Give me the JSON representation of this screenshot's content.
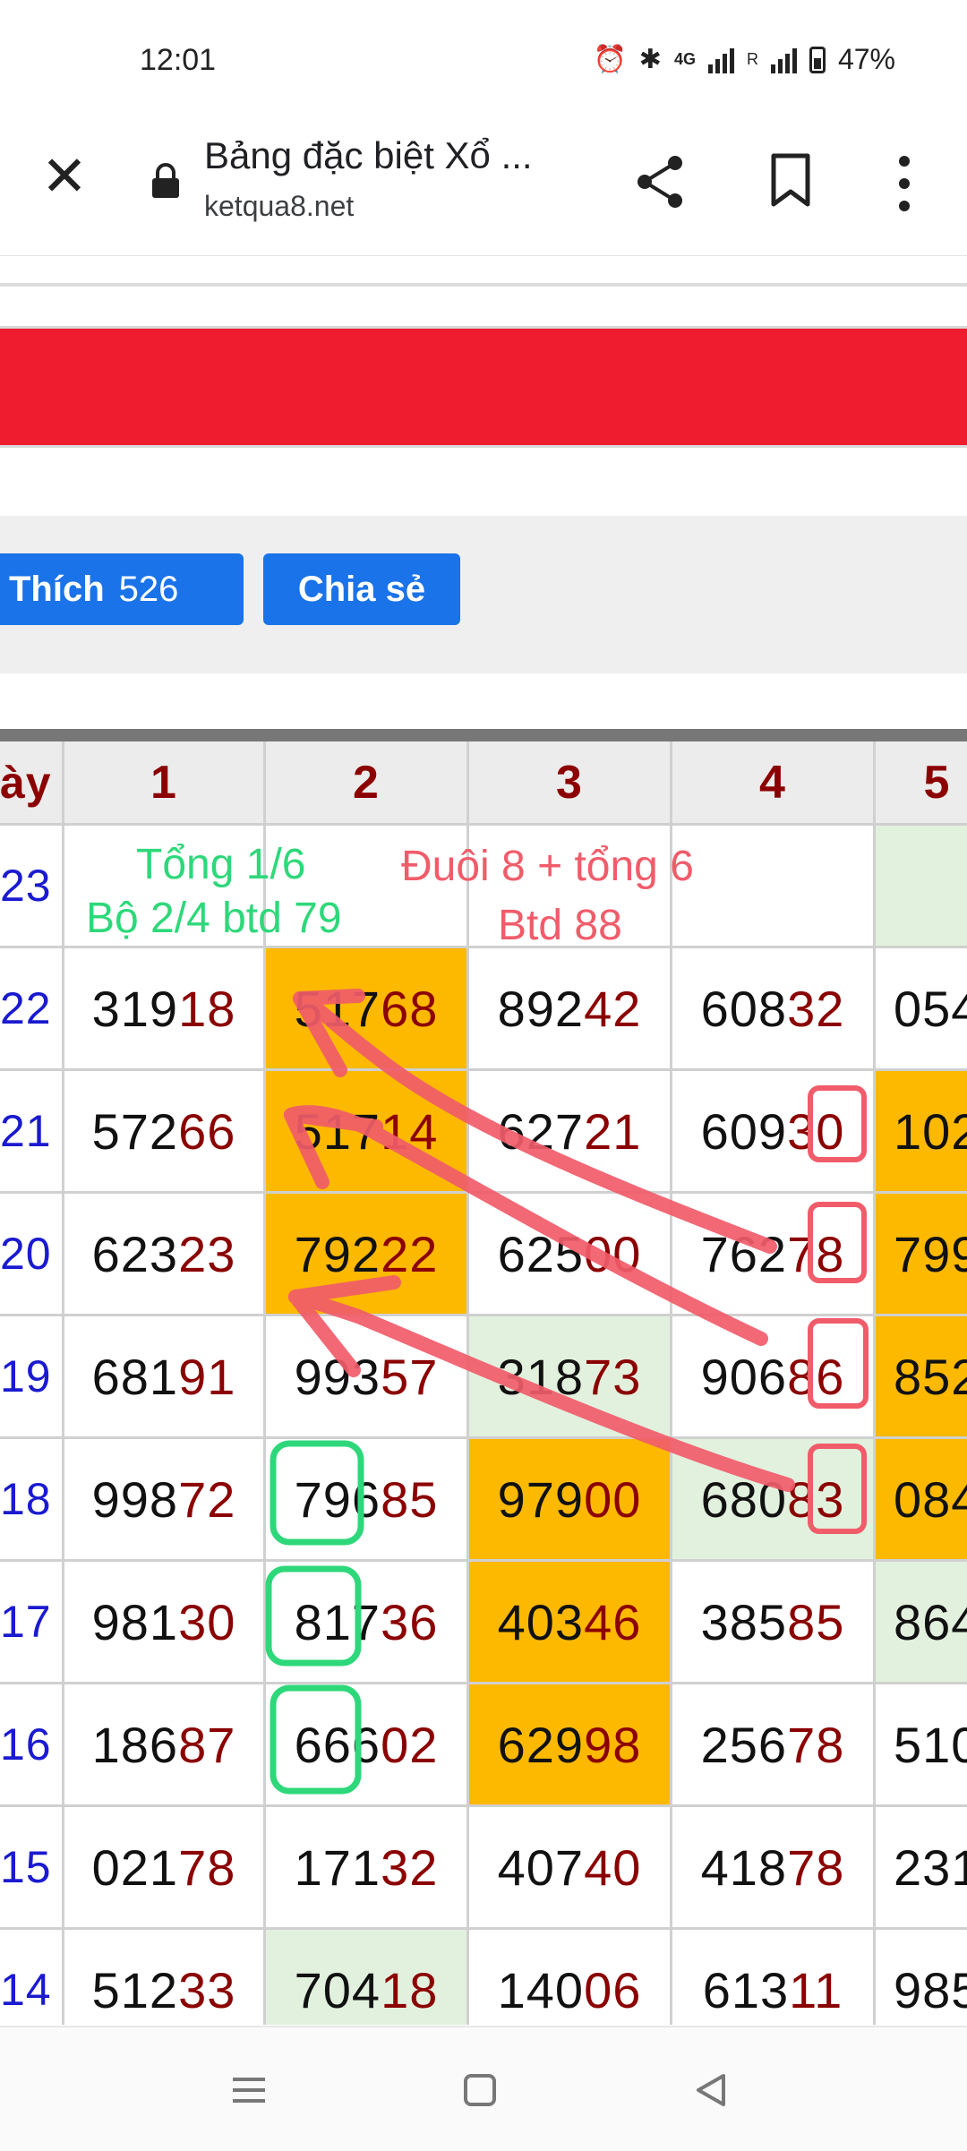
{
  "status_bar": {
    "time": "12:01",
    "network": "4G",
    "roaming": "R",
    "battery": "47%",
    "icons": [
      "alarm-icon",
      "bluetooth-icon",
      "signal-icon",
      "battery-icon"
    ]
  },
  "browser": {
    "title": "Bảng đặc biệt Xổ ...",
    "url": "ketqua8.net",
    "icons": [
      "close-icon",
      "lock-icon",
      "share-icon",
      "bookmark-icon",
      "more-icon"
    ]
  },
  "social": {
    "like_label": "Thích",
    "like_count": "526",
    "share_label": "Chia sẻ"
  },
  "table": {
    "first_header": "ày",
    "columns": [
      "1",
      "2",
      "3",
      "4",
      "5"
    ],
    "rows": [
      {
        "label": "23",
        "cells": [
          {
            "head": "",
            "tail": ""
          },
          {
            "head": "",
            "tail": ""
          },
          {
            "head": "",
            "tail": ""
          },
          {
            "head": "",
            "tail": ""
          },
          {
            "head": "",
            "tail": ""
          }
        ]
      },
      {
        "label": "22",
        "cells": [
          {
            "head": "319",
            "tail": "18"
          },
          {
            "head": "517",
            "tail": "68"
          },
          {
            "head": "892",
            "tail": "42"
          },
          {
            "head": "608",
            "tail": "32"
          },
          {
            "head": "054",
            "tail": ""
          }
        ]
      },
      {
        "label": "21",
        "cells": [
          {
            "head": "572",
            "tail": "66"
          },
          {
            "head": "517",
            "tail": "14"
          },
          {
            "head": "627",
            "tail": "21"
          },
          {
            "head": "609",
            "tail": "30"
          },
          {
            "head": "102",
            "tail": ""
          }
        ]
      },
      {
        "label": "20",
        "cells": [
          {
            "head": "623",
            "tail": "23"
          },
          {
            "head": "792",
            "tail": "22"
          },
          {
            "head": "625",
            "tail": "00"
          },
          {
            "head": "762",
            "tail": "78"
          },
          {
            "head": "799",
            "tail": ""
          }
        ]
      },
      {
        "label": "19",
        "cells": [
          {
            "head": "681",
            "tail": "91"
          },
          {
            "head": "993",
            "tail": "57"
          },
          {
            "head": "318",
            "tail": "73"
          },
          {
            "head": "906",
            "tail": "86"
          },
          {
            "head": "852",
            "tail": ""
          }
        ]
      },
      {
        "label": "18",
        "cells": [
          {
            "head": "998",
            "tail": "72"
          },
          {
            "head": "796",
            "tail": "85"
          },
          {
            "head": "979",
            "tail": "00"
          },
          {
            "head": "680",
            "tail": "83"
          },
          {
            "head": "084",
            "tail": ""
          }
        ]
      },
      {
        "label": "17",
        "cells": [
          {
            "head": "981",
            "tail": "30"
          },
          {
            "head": "817",
            "tail": "36"
          },
          {
            "head": "403",
            "tail": "46"
          },
          {
            "head": "385",
            "tail": "85"
          },
          {
            "head": "864",
            "tail": ""
          }
        ]
      },
      {
        "label": "16",
        "cells": [
          {
            "head": "186",
            "tail": "87"
          },
          {
            "head": "666",
            "tail": "02"
          },
          {
            "head": "629",
            "tail": "98"
          },
          {
            "head": "256",
            "tail": "78"
          },
          {
            "head": "510",
            "tail": ""
          }
        ]
      },
      {
        "label": "15",
        "cells": [
          {
            "head": "021",
            "tail": "78"
          },
          {
            "head": "171",
            "tail": "32"
          },
          {
            "head": "407",
            "tail": "40"
          },
          {
            "head": "418",
            "tail": "78"
          },
          {
            "head": "231",
            "tail": ""
          }
        ]
      },
      {
        "label": "14",
        "cells": [
          {
            "head": "512",
            "tail": "33"
          },
          {
            "head": "704",
            "tail": "18"
          },
          {
            "head": "140",
            "tail": "06"
          },
          {
            "head": "613",
            "tail": "11"
          },
          {
            "head": "985",
            "tail": ""
          }
        ]
      }
    ],
    "highlight_orange": [
      "1-1",
      "2-1",
      "3-1",
      "5-2",
      "6-2",
      "7-2",
      "2-4",
      "3-4",
      "4-4",
      "5-4"
    ],
    "highlight_green": [
      "0-4",
      "1-5",
      "4-2",
      "5-3",
      "6-4",
      "7-5",
      "9-1"
    ]
  },
  "annotations": {
    "note1": "Tổng 1/6",
    "note2": "Bộ 2/4 btd 79",
    "note3": "Đuôi 8 + tổng 6",
    "note4": "Btd 88",
    "green_color": "#2ed87a",
    "red_color": "#f15c6a"
  },
  "navbar": {
    "icons": [
      "menu-icon",
      "home-icon",
      "back-icon"
    ]
  }
}
